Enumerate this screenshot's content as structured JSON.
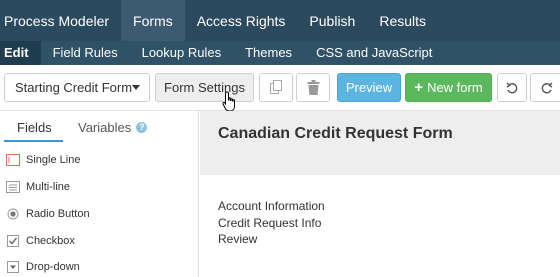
{
  "top_nav": {
    "items": [
      {
        "label": "Process Modeler"
      },
      {
        "label": "Forms"
      },
      {
        "label": "Access Rights"
      },
      {
        "label": "Publish"
      },
      {
        "label": "Results"
      }
    ],
    "active": "Forms"
  },
  "sub_nav": {
    "items": [
      {
        "label": "Edit"
      },
      {
        "label": "Field Rules"
      },
      {
        "label": "Lookup Rules"
      },
      {
        "label": "Themes"
      },
      {
        "label": "CSS and JavaScript"
      }
    ],
    "active": "Edit"
  },
  "toolbar": {
    "form_select_value": "Starting Credit Form",
    "settings_label": "Form Settings",
    "preview_label": "Preview",
    "new_form_label": "New form",
    "new_form_icon": "plus-icon",
    "copy_icon": "copy-icon",
    "delete_icon": "trash-icon",
    "undo_icon": "undo-icon",
    "redo_icon": "redo-icon"
  },
  "sidebar": {
    "tabs": [
      {
        "label": "Fields"
      },
      {
        "label": "Variables",
        "icon": "help-icon",
        "help_glyph": "?"
      }
    ],
    "active_tab": "Fields",
    "fields": [
      {
        "label": "Single Line",
        "icon": "single-line-icon"
      },
      {
        "label": "Multi-line",
        "icon": "multi-line-icon"
      },
      {
        "label": "Radio Button",
        "icon": "radio-icon"
      },
      {
        "label": "Checkbox",
        "icon": "checkbox-icon"
      },
      {
        "label": "Drop-down",
        "icon": "dropdown-icon"
      }
    ]
  },
  "form": {
    "title": "Canadian Credit Request Form",
    "sections": [
      "Account Information",
      "Credit Request Info",
      "Review"
    ]
  },
  "colors": {
    "top_nav_bg": "#2c4a5e",
    "sub_nav_bg": "#2f5267",
    "preview_bg": "#5bb5e0",
    "new_form_bg": "#5cb85c",
    "tab_underline": "#3b97d3"
  }
}
